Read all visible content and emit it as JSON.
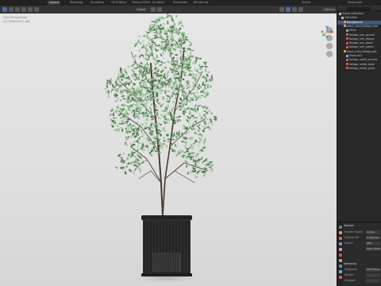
{
  "topbar": {
    "workspaces": [
      "Layout",
      "Modeling",
      "Sculpting",
      "UV Editing",
      "Texture Paint",
      "Shading",
      "Animation",
      "Rendering"
    ],
    "scene_label": "Scene",
    "view_layer_label": "ViewLayer"
  },
  "viewport": {
    "shading_label": "Global",
    "options_label": "Options",
    "info_line1": "User Perspective",
    "info_line2": "(1) Collection | pot"
  },
  "outliner": {
    "header": "Scene Collection",
    "rows": [
      {
        "label": "Scene Collection",
        "indent": 0,
        "color": "#bfbfbf",
        "selected": false
      },
      {
        "label": "Collection",
        "indent": 1,
        "color": "#bfbfbf",
        "selected": false
      },
      {
        "label": "Background",
        "indent": 2,
        "color": "#e0a04a",
        "selected": true
      },
      {
        "label": "plant_shell_foliage_tree",
        "indent": 2,
        "color": "#e0a04a",
        "selected": false
      },
      {
        "label": "Mesh",
        "indent": 3,
        "color": "#6fb7e0",
        "selected": false
      },
      {
        "label": "foliage_arm_accent",
        "indent": 3,
        "color": "#d05a5a",
        "selected": false
      },
      {
        "label": "foliage_arm_leaves",
        "indent": 3,
        "color": "#d05a5a",
        "selected": false
      },
      {
        "label": "foliage_arm_plant",
        "indent": 3,
        "color": "#d05a5a",
        "selected": false
      },
      {
        "label": "foliage_arm_stems",
        "indent": 3,
        "color": "#d05a5a",
        "selected": false
      },
      {
        "label": "plant_shell_foliage_pot",
        "indent": 2,
        "color": "#e0a04a",
        "selected": false
      },
      {
        "label": "Plane.001",
        "indent": 3,
        "color": "#6fb7e0",
        "selected": false
      },
      {
        "label": "foliage_metal_accent",
        "indent": 3,
        "color": "#d05a5a",
        "selected": false
      },
      {
        "label": "foliage_metal_body",
        "indent": 3,
        "color": "#d05a5a",
        "selected": false
      },
      {
        "label": "foliage_metal_plant",
        "indent": 3,
        "color": "#d05a5a",
        "selected": false
      }
    ]
  },
  "properties": {
    "section_title": "Texture",
    "rows": [
      {
        "label": "Render Engine",
        "value": "Cycles"
      },
      {
        "label": "Feature Set",
        "value": "Supported"
      },
      {
        "label": "Device",
        "value": "GPU"
      },
      {
        "label": "",
        "value": "Open Shading"
      }
    ],
    "sampling_title": "Sampling",
    "sampling_rows": [
      {
        "label": "Integrator",
        "value": "Path Tracing"
      },
      {
        "label": "Render",
        "value": ""
      },
      {
        "label": "Viewport",
        "value": ""
      }
    ]
  },
  "colors": {
    "accent": "#3f5a83",
    "viewport_bg": "#e3e3e3",
    "pot": "#2b2b2b",
    "leaf_light": "#9bc49a",
    "leaf_dark": "#4f7450"
  }
}
